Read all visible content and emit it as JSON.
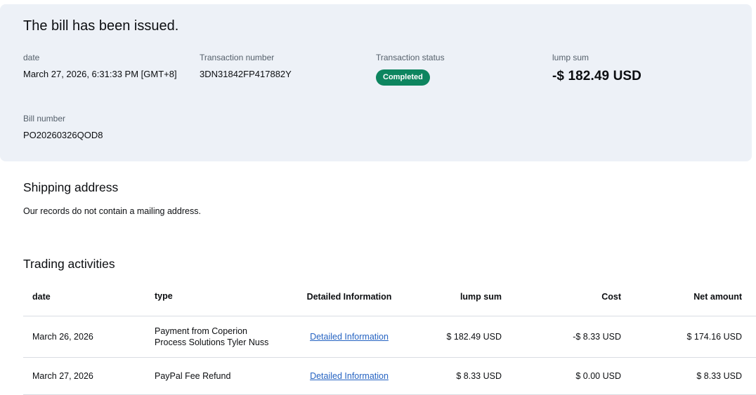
{
  "summary": {
    "title": "The bill has been issued.",
    "date_label": "date",
    "date_value": "March 27, 2026, 6:31:33 PM [GMT+8]",
    "transaction_number_label": "Transaction number",
    "transaction_number_value": "3DN31842FP417882Y",
    "transaction_status_label": "Transaction status",
    "transaction_status_value": "Completed",
    "lump_sum_label": "lump sum",
    "lump_sum_value": "-$ 182.49 USD",
    "bill_number_label": "Bill number",
    "bill_number_value": "PO20260326QOD8"
  },
  "shipping": {
    "heading": "Shipping address",
    "note": "Our records do not contain a mailing address."
  },
  "activities": {
    "heading": "Trading activities",
    "columns": {
      "date": "date",
      "type": "type",
      "info": "Detailed Information",
      "lump_sum": "lump sum",
      "cost": "Cost",
      "net": "Net amount"
    },
    "rows": [
      {
        "date": "March 26, 2026",
        "type": "Payment from Coperion\nProcess Solutions Tyler Nuss",
        "link": "Detailed Information",
        "lump_sum": "$ 182.49 USD",
        "cost": "-$ 8.33 USD",
        "net": "$ 174.16 USD"
      },
      {
        "date": "March 27, 2026",
        "type": "PayPal Fee Refund",
        "link": "Detailed Information",
        "lump_sum": "$ 8.33 USD",
        "cost": "$ 0.00 USD",
        "net": "$ 8.33 USD"
      }
    ]
  },
  "colors": {
    "panel_background": "#edf1f7",
    "status_badge_green": "#0d855f",
    "link_blue": "#2563c2",
    "divider_gray": "#d9dce2",
    "label_gray": "#55606b"
  }
}
